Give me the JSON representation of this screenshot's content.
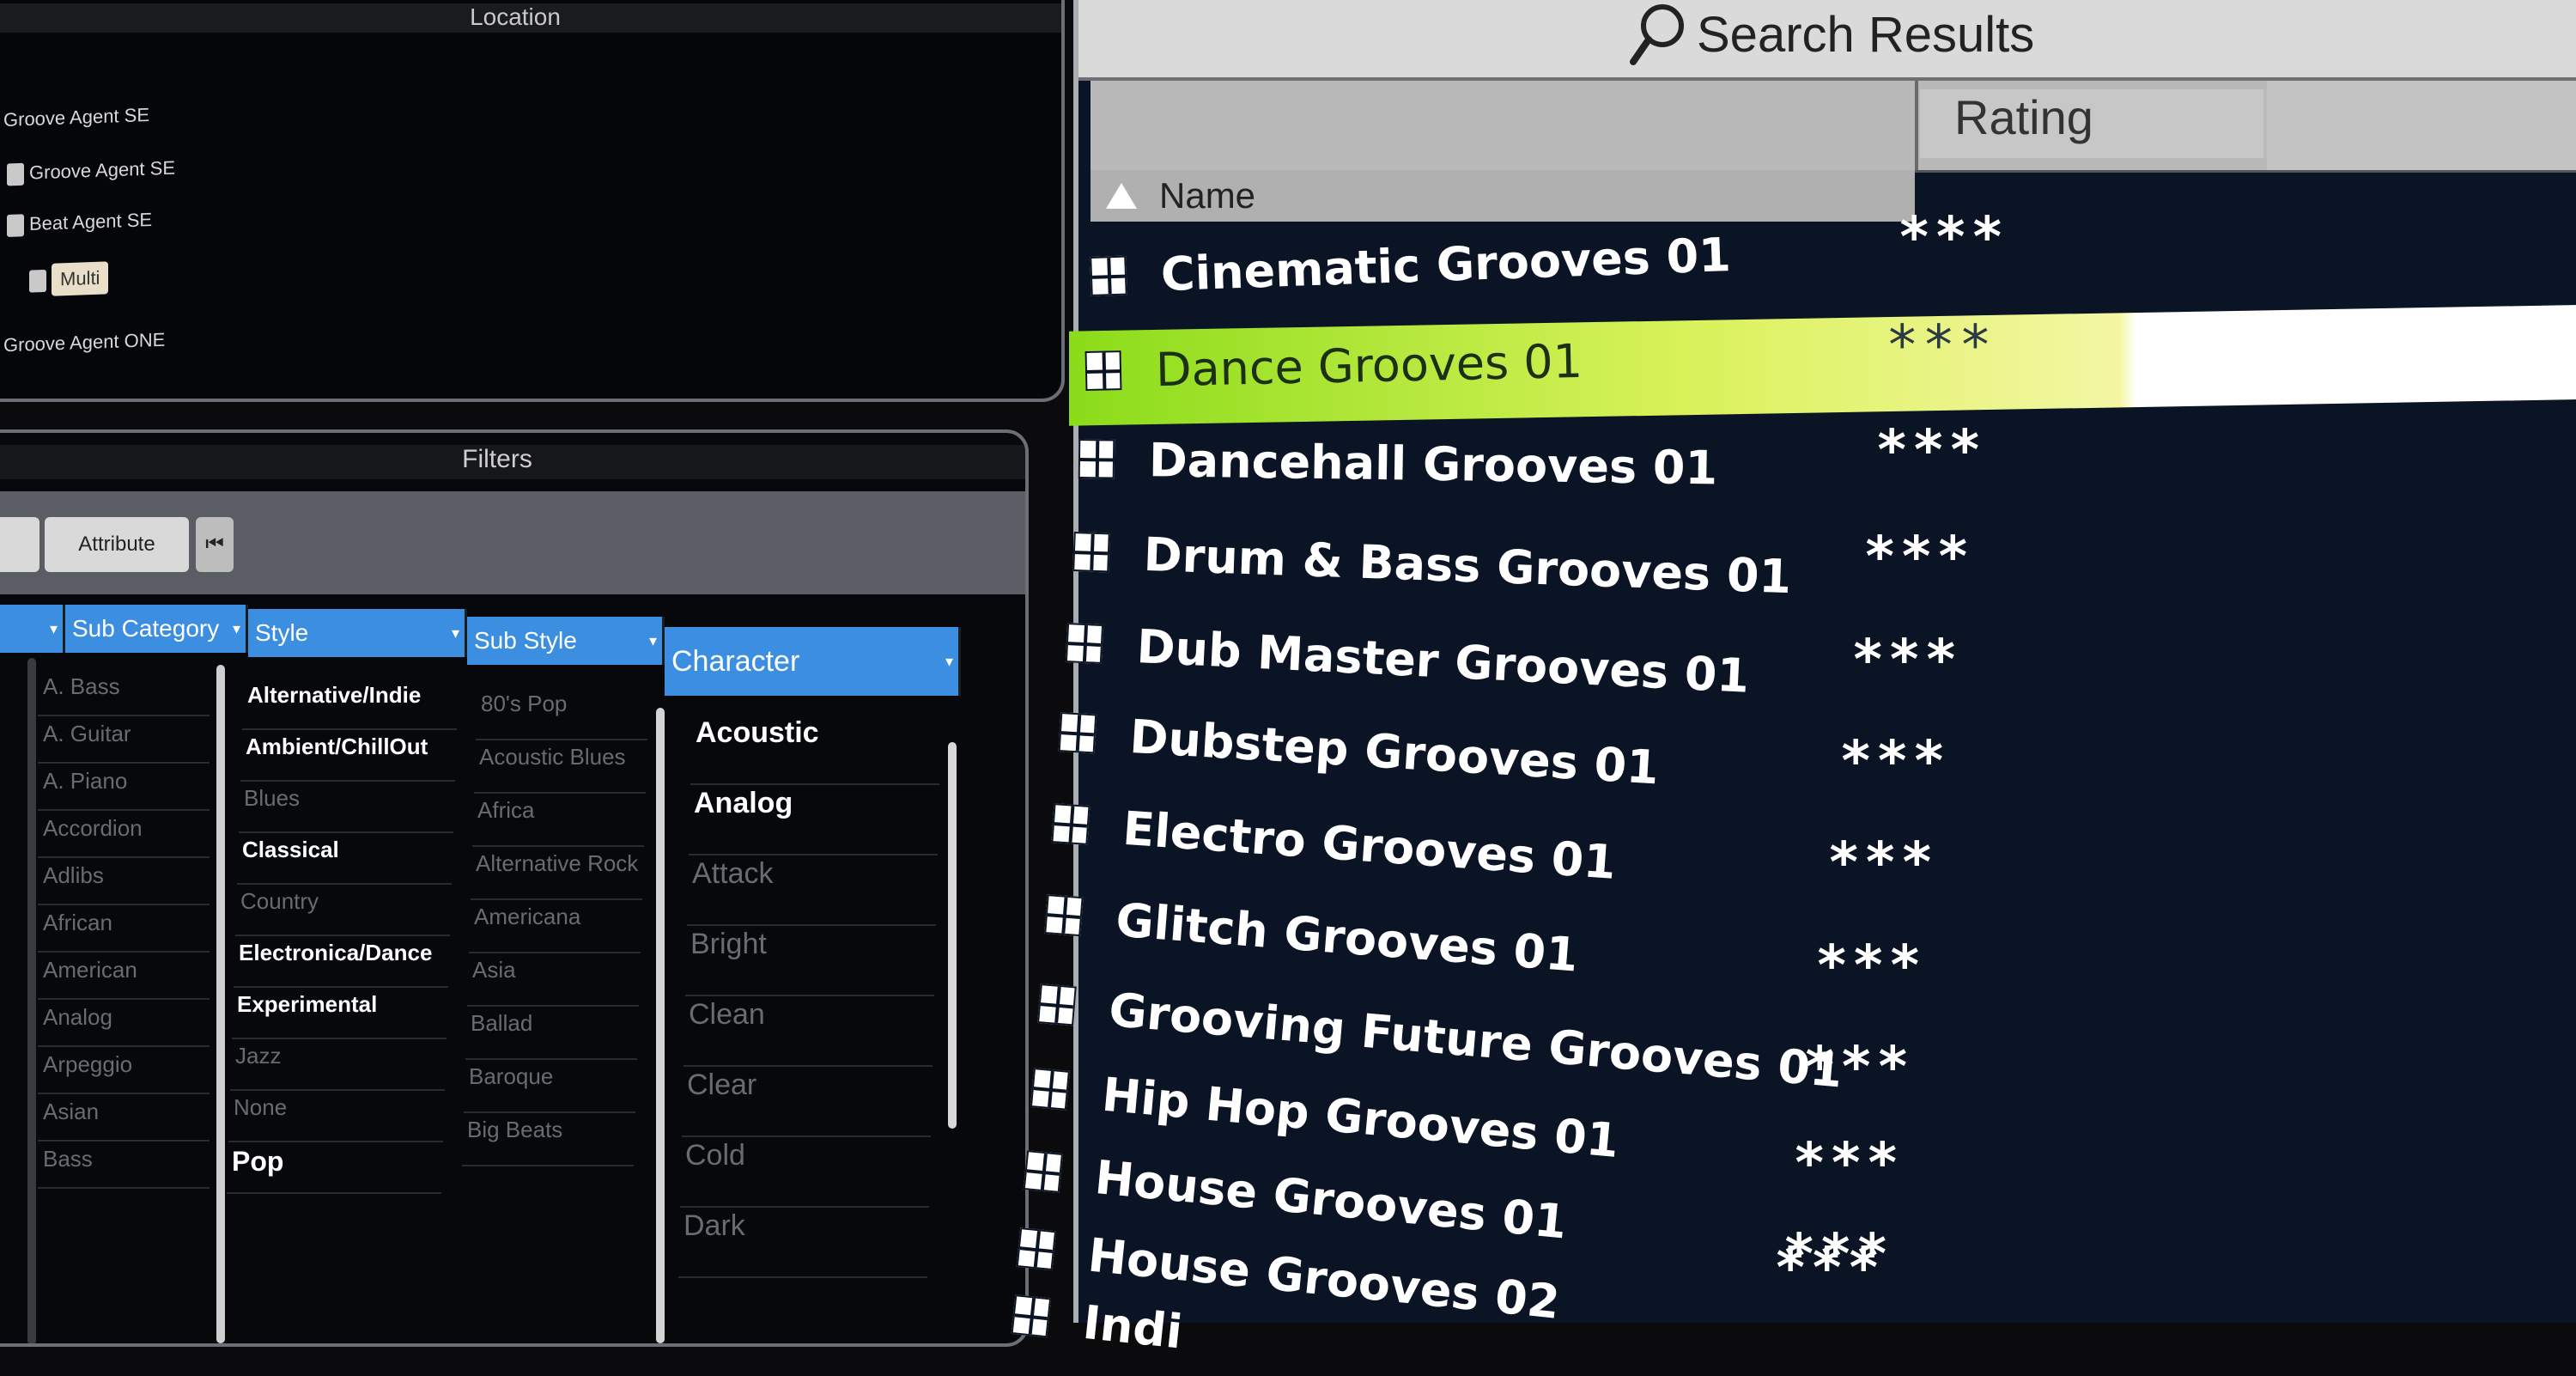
{
  "location_panel": {
    "title": "Location",
    "tree": [
      "Groove Agent SE",
      "Groove Agent SE",
      "Beat Agent SE",
      "Multi",
      "Groove Agent ONE"
    ]
  },
  "filters": {
    "title": "Filters",
    "toolbar": {
      "attribute_label": "Attribute",
      "reset_symbol": "⏮"
    },
    "columns": [
      {
        "header": "Sub Category",
        "items": [
          "A. Bass",
          "A. Guitar",
          "A. Piano",
          "Accordion",
          "Adlibs",
          "African",
          "American",
          "Analog",
          "Arpeggio",
          "Asian",
          "Bass"
        ]
      },
      {
        "header": "Style",
        "items": [
          "Alternative/Indie",
          "Ambient/ChillOut",
          "Blues",
          "Classical",
          "Country",
          "Electronica/Dance",
          "Experimental",
          "Jazz",
          "None",
          "Pop"
        ]
      },
      {
        "header": "Sub Style",
        "items": [
          "80's Pop",
          "Acoustic Blues",
          "Africa",
          "Alternative Rock",
          "Americana",
          "Asia",
          "Ballad",
          "Baroque",
          "Big Beats"
        ]
      },
      {
        "header": "Character",
        "items": [
          "Acoustic",
          "Analog",
          "Attack",
          "Bright",
          "Clean",
          "Clear",
          "Cold",
          "Dark"
        ]
      }
    ],
    "bold_styles": [
      "Alternative/Indie",
      "Ambient/ChillOut",
      "Classical",
      "Electronica/Dance",
      "Experimental",
      "Pop"
    ],
    "bold_characters": [
      "Acoustic",
      "Analog"
    ]
  },
  "results": {
    "title": "Search Results",
    "columns": {
      "name": "Name",
      "rating": "Rating"
    },
    "selected_index": 1,
    "rows": [
      {
        "name": "Cinematic Grooves 01",
        "rating": "***"
      },
      {
        "name": "Dance Grooves 01",
        "rating": "***"
      },
      {
        "name": "Dancehall Grooves 01",
        "rating": "***"
      },
      {
        "name": "Drum & Bass Grooves 01",
        "rating": "***"
      },
      {
        "name": "Dub Master Grooves 01",
        "rating": "***"
      },
      {
        "name": "Dubstep Grooves 01",
        "rating": "***"
      },
      {
        "name": "Electro Grooves 01",
        "rating": "***"
      },
      {
        "name": "Glitch Grooves 01",
        "rating": "***"
      },
      {
        "name": "Grooving Future Grooves 01",
        "rating": "***"
      },
      {
        "name": "Hip Hop Grooves 01",
        "rating": "***"
      },
      {
        "name": "House Grooves 01",
        "rating": "***"
      },
      {
        "name": "House Grooves 02",
        "rating": "***"
      },
      {
        "name": "Indi",
        "rating": "***"
      }
    ]
  },
  "colors": {
    "column_header_blue": "#3c8fe0",
    "selection_green": "#8bdc1a",
    "results_bg": "#0b1424"
  }
}
